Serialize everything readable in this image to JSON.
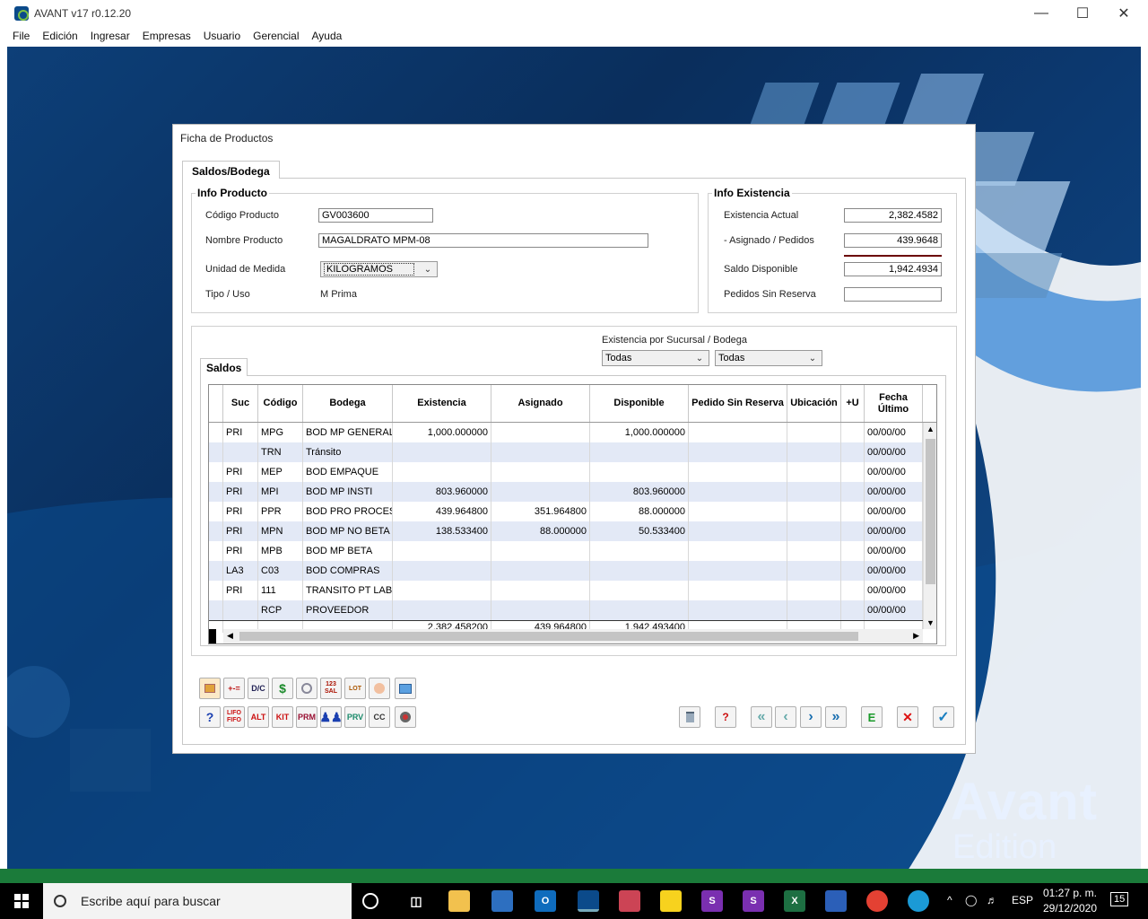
{
  "window": {
    "title": "AVANT v17 r0.12.20"
  },
  "menu": [
    "File",
    "Edición",
    "Ingresar",
    "Empresas",
    "Usuario",
    "Gerencial",
    "Ayuda"
  ],
  "brand": {
    "line1": "Avant",
    "line2": "Edition"
  },
  "dialog": {
    "title": "Ficha de Productos",
    "tab_main": "Saldos/Bodega",
    "info_producto": {
      "title": "Info Producto",
      "codigo_label": "Código Producto",
      "codigo_value": "GV003600",
      "nombre_label": "Nombre Producto",
      "nombre_value": "MAGALDRATO MPM-08",
      "unidad_label": "Unidad de Medida",
      "unidad_value": "KILOGRAMOS",
      "tipo_label": "Tipo / Uso",
      "tipo_value": "M Prima"
    },
    "info_existencia": {
      "title": "Info Existencia",
      "existencia_label": "Existencia Actual",
      "existencia_value": "2,382.4582",
      "asignado_label": "- Asignado / Pedidos",
      "asignado_value": "439.9648",
      "saldo_label": "Saldo Disponible",
      "saldo_value": "1,942.4934",
      "pedidos_label": "Pedidos Sin Reserva",
      "pedidos_value": ""
    },
    "saldos": {
      "tab": "Saldos",
      "filter_label": "Existencia por Sucursal / Bodega",
      "filter1": "Todas",
      "filter2": "Todas",
      "columns": [
        "Suc",
        "Código",
        "Bodega",
        "Existencia",
        "Asignado",
        "Disponible",
        "Pedido Sin Reserva",
        "Ubicación",
        "+U",
        "Fecha Último"
      ],
      "rows": [
        [
          "PRI",
          "MPG",
          "BOD MP GENERAL",
          "1,000.000000",
          "",
          "1,000.000000",
          "",
          "",
          "",
          "00/00/00"
        ],
        [
          "",
          "TRN",
          "Tránsito",
          "",
          "",
          "",
          "",
          "",
          "",
          "00/00/00"
        ],
        [
          "PRI",
          "MEP",
          "BOD EMPAQUE",
          "",
          "",
          "",
          "",
          "",
          "",
          "00/00/00"
        ],
        [
          "PRI",
          "MPI",
          "BOD MP INSTI",
          "803.960000",
          "",
          "803.960000",
          "",
          "",
          "",
          "00/00/00"
        ],
        [
          "PRI",
          "PPR",
          "BOD PRO PROCESO",
          "439.964800",
          "351.964800",
          "88.000000",
          "",
          "",
          "",
          "00/00/00"
        ],
        [
          "PRI",
          "MPN",
          "BOD MP NO BETA",
          "138.533400",
          "88.000000",
          "50.533400",
          "",
          "",
          "",
          "00/00/00"
        ],
        [
          "PRI",
          "MPB",
          "BOD MP BETA",
          "",
          "",
          "",
          "",
          "",
          "",
          "00/00/00"
        ],
        [
          "LA3",
          "C03",
          "BOD COMPRAS",
          "",
          "",
          "",
          "",
          "",
          "",
          "00/00/00"
        ],
        [
          "PRI",
          "111",
          "TRANSITO PT LAB",
          "",
          "",
          "",
          "",
          "",
          "",
          "00/00/00"
        ],
        [
          "",
          "RCP",
          "PROVEEDOR",
          "",
          "",
          "",
          "",
          "",
          "",
          "00/00/00"
        ]
      ],
      "totals": [
        "",
        "",
        "",
        "2,382.458200",
        "439.964800",
        "1,942.493400",
        "",
        "",
        "",
        ""
      ]
    },
    "toolbar_row1": [
      "",
      "+-=",
      "D/C",
      "$",
      "",
      "123 SAL",
      "LOT",
      "",
      ""
    ],
    "toolbar_row2": [
      "?",
      "LIFO FIFO",
      "ALT",
      "KIT",
      "PRM",
      "",
      "PRV",
      "CC",
      ""
    ],
    "nav": {
      "delete": "",
      "find": "",
      "first": "«",
      "prev": "‹",
      "next": "›",
      "last": "»",
      "edit": "E",
      "cancel": "✕",
      "ok": "✓"
    }
  },
  "taskbar": {
    "search_placeholder": "Escribe aquí para buscar",
    "lang": "ESP",
    "time": "01:27 p. m.",
    "date": "29/12/2020",
    "notif_count": "15"
  },
  "colors": {
    "accent": "#1a5fb4",
    "row_alt": "#e3e9f6",
    "desktop": "#0a3a6e"
  }
}
